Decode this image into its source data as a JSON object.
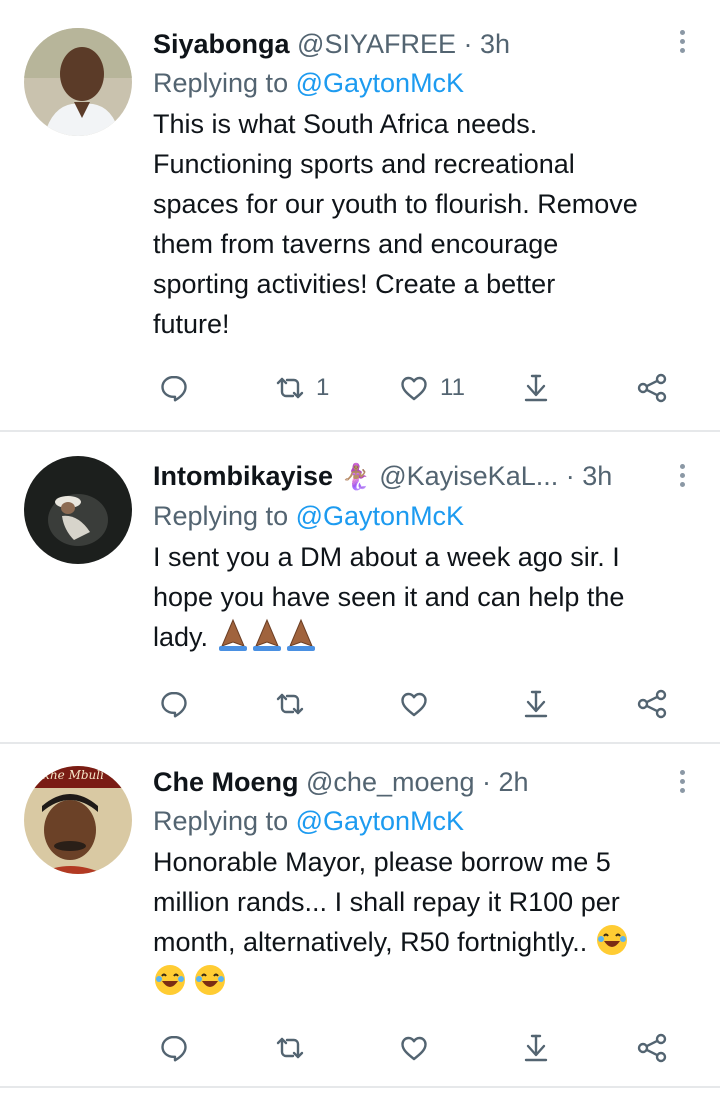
{
  "tweets": [
    {
      "name": "Siyabonga",
      "name_emoji": "",
      "handle": "@SIYAFREE",
      "time": "3h",
      "replying_label": "Replying to",
      "replying_to": "@GaytonMcK",
      "text": "This is what South Africa needs.\nFunctioning sports and recreational\nspaces for our youth to flourish. Remove\nthem from taverns and encourage\nsporting activities! Create a better\nfuture!",
      "retweets": "1",
      "likes": "11"
    },
    {
      "name": "Intombikayise",
      "name_emoji": "🧜🏽‍♀️",
      "handle": "@KayiseKaL...",
      "time": "3h",
      "replying_label": "Replying to",
      "replying_to": "@GaytonMcK",
      "text": "I sent you a DM about a week ago sir. I\nhope you have seen it and can help the\nlady.",
      "retweets": "",
      "likes": ""
    },
    {
      "name": "Che Moeng",
      "name_emoji": "",
      "handle": "@che_moeng",
      "time": "2h",
      "replying_label": "Replying to",
      "replying_to": "@GaytonMcK",
      "text": "Honorable Mayor, please borrow me 5\nmillion rands... I shall repay it R100 per\nmonth, alternatively, R50 fortnightly..",
      "retweets": "",
      "likes": "",
      "avatar_text": "Akhe Mbuli"
    }
  ],
  "separator": " · ",
  "icons": [
    "reply-icon",
    "retweet-icon",
    "like-icon",
    "download-icon",
    "share-icon",
    "more-icon"
  ],
  "colors": {
    "text": "#0f1419",
    "muted": "#536471",
    "link": "#1d9bf0",
    "divider": "#e6e8ea"
  }
}
